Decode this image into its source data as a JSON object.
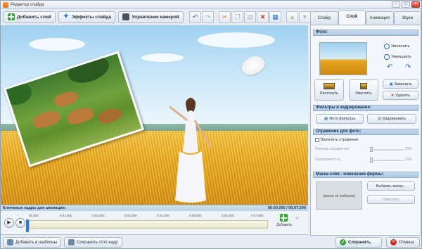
{
  "window": {
    "title": "Редактор слайда"
  },
  "toolbar": {
    "add_layer": "Добавить слой",
    "effects": "Эффекты слайда",
    "camera": "Управление камерой"
  },
  "tabs": [
    "Слайд",
    "Слой",
    "Анимация",
    "Звуки"
  ],
  "photo": {
    "section": "Фото:",
    "zoom_in": "Увеличить",
    "zoom_out": "Уменьшить",
    "stretch": "Растянуть",
    "shrink": "Уместить",
    "replace": "Заменить",
    "delete": "Удалить"
  },
  "filters": {
    "section": "Фильтры и кадрирование:",
    "photo_filters": "Фото фильтры",
    "crop": "Кадрировать"
  },
  "reflection": {
    "section": "Отражение для фото:",
    "enable": "Включить отражение",
    "size_label": "Размер отражения:",
    "size_value": "33%",
    "opacity_label": "Прозрачность:",
    "opacity_value": "25%"
  },
  "mask": {
    "section": "Маска слоя - изменение формы:",
    "not_selected": "(маска не выбрана)",
    "choose": "Выбрать маску...",
    "clear": "Очистить"
  },
  "timeline": {
    "header": "Ключевые кадры для анимации:",
    "time": "00:00.000 / 00:07.000",
    "ticks": [
      "00.000",
      "0:01.000",
      "0:02.000",
      "0:03.000",
      "0:04.000",
      "0:05.000",
      "0:06.000",
      "0:07.000"
    ],
    "add": "Добавить"
  },
  "bottom": {
    "add_template": "Добавить в шаблоны",
    "save_still": "Сохранить стоп-кадр",
    "save": "Сохранить",
    "cancel": "Отмена"
  }
}
